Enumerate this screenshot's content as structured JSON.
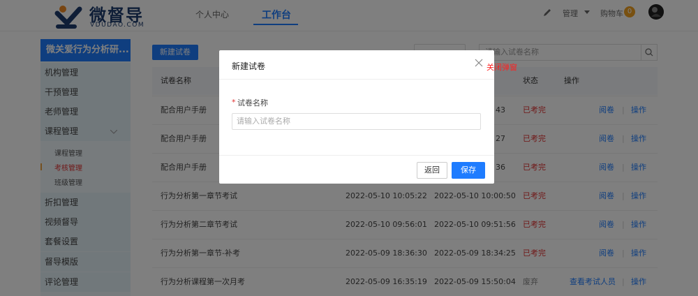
{
  "header": {
    "brand": "微督导",
    "brand_sub": "VDUDAO.COM",
    "nav": [
      "个人中心",
      "工作台"
    ],
    "manage_label": "管理",
    "cart_label": "购物车",
    "cart_count": "0"
  },
  "sidebar": {
    "title": "微关爱行为分析研...",
    "items": [
      "机构管理",
      "干预管理",
      "老师管理",
      "课程管理"
    ],
    "sub_items": [
      "课程管理",
      "考核管理",
      "班级管理"
    ],
    "more_items": [
      "折扣管理",
      "视频督导",
      "套餐设置",
      "督导模版",
      "评论管理"
    ]
  },
  "toolbar": {
    "new_paper_label": "新建试卷",
    "search_placeholder": "请输入试卷名称"
  },
  "table": {
    "headers": [
      "试卷名称",
      "状态",
      "操作"
    ],
    "rows": [
      {
        "name": "配合用户手册",
        "create": "",
        "update": "43",
        "status": "已考完",
        "action1": "阅卷",
        "action2": "操作"
      },
      {
        "name": "配合用户手册",
        "create": "",
        "update": "27",
        "status": "已考完",
        "action1": "阅卷",
        "action2": "操作"
      },
      {
        "name": "配合用户手册",
        "create": "",
        "update": "36",
        "status": "已考完",
        "action1": "阅卷",
        "action2": "操作"
      },
      {
        "name": "行为分析第一章节考试",
        "create": "2022-05-10 10:05:22",
        "update": "2022-05-10 10:00:50",
        "status": "已考完",
        "action1": "阅卷",
        "action2": "操作"
      },
      {
        "name": "行为分析第二章节考试",
        "create": "2022-05-10 09:56:01",
        "update": "2022-05-10 09:51:56",
        "status": "已考完",
        "action1": "阅卷",
        "action2": "操作"
      },
      {
        "name": "行为分析第一章节-补考",
        "create": "2022-05-09 18:36:30",
        "update": "2022-05-09 18:34:25",
        "status": "已考完",
        "action1": "阅卷",
        "action2": "操作"
      },
      {
        "name": "行为分析课程第一次月考",
        "create": "2022-05-09 16:35:19",
        "update": "2022-05-09 15:50:04",
        "status": "废弃",
        "action1": "查看考试人员",
        "action2": "操作"
      }
    ]
  },
  "modal": {
    "title": "新建试卷",
    "field_star": "*",
    "field_label": "试卷名称",
    "field_placeholder": "请输入试卷名称",
    "back_label": "返回",
    "save_label": "保存"
  },
  "annotation": {
    "close_hint": "关闭弹窗"
  },
  "colors": {
    "accent": "#1e7cff",
    "danger": "#e03030",
    "brand": "#1e3c6e"
  }
}
